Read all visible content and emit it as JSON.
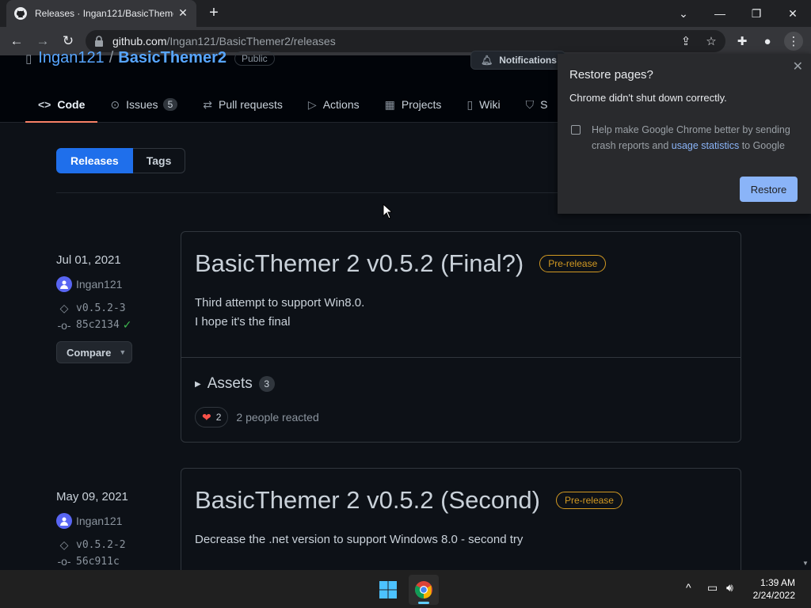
{
  "browser": {
    "tab_title": "Releases · Ingan121/BasicThemer2",
    "url_host": "github.com",
    "url_path": "/Ingan121/BasicThemer2/releases"
  },
  "repo": {
    "owner": "Ingan121",
    "name": "BasicThemer2",
    "visibility": "Public",
    "notifications_label": "Notifications",
    "nav": [
      {
        "label": "Code"
      },
      {
        "label": "Issues",
        "count": "5"
      },
      {
        "label": "Pull requests"
      },
      {
        "label": "Actions"
      },
      {
        "label": "Projects"
      },
      {
        "label": "Wiki"
      },
      {
        "label": "S"
      }
    ]
  },
  "subnav": {
    "releases": "Releases",
    "tags": "Tags"
  },
  "releases": [
    {
      "date": "Jul 01, 2021",
      "author": "Ingan121",
      "tag": "v0.5.2-3",
      "commit": "85c2134",
      "compare": "Compare",
      "title": "BasicThemer 2 v0.5.2 (Final?)",
      "badge": "Pre-release",
      "body1": "Third attempt to support Win8.0.",
      "body2": "I hope it's the final",
      "assets_label": "Assets",
      "assets_count": "3",
      "reaction_count": "2",
      "reaction_text": "2 people reacted"
    },
    {
      "date": "May 09, 2021",
      "author": "Ingan121",
      "tag": "v0.5.2-2",
      "commit": "56c911c",
      "title": "BasicThemer 2 v0.5.2 (Second)",
      "badge": "Pre-release",
      "body1": "Decrease the .net version to support Windows 8.0 - second try"
    }
  ],
  "popup": {
    "title": "Restore pages?",
    "message": "Chrome didn't shut down correctly.",
    "check_pre": "Help make Google Chrome better by sending crash reports and ",
    "check_link": "usage statistics",
    "check_post": " to Google",
    "button": "Restore"
  },
  "taskbar": {
    "time": "1:39 AM",
    "date": "2/24/2022"
  }
}
